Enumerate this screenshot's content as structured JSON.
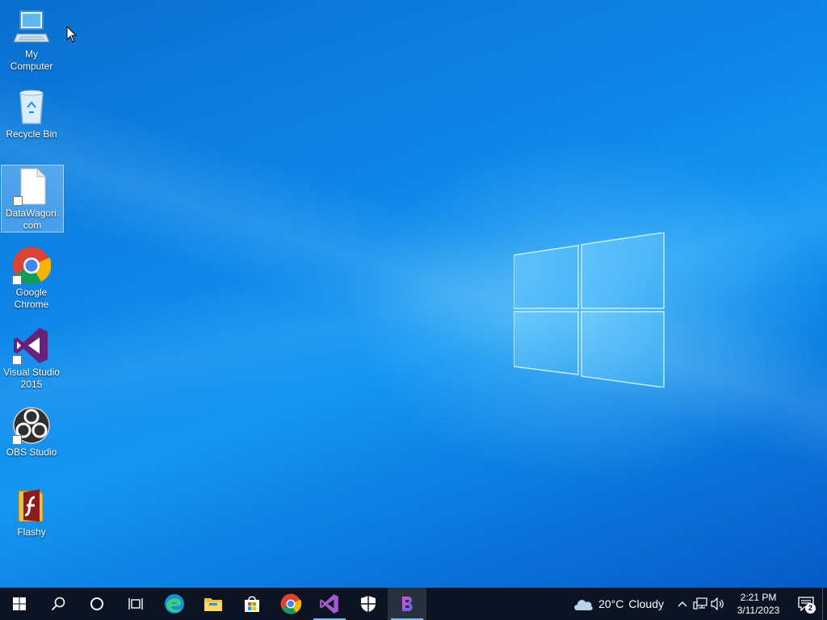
{
  "desktop": {
    "icons": [
      {
        "label": "My Computer",
        "icon": "computer-icon"
      },
      {
        "label": "Recycle Bin",
        "icon": "recycle-bin-icon"
      },
      {
        "label": "DataWagon.com",
        "icon": "file-shortcut-icon",
        "selected": true
      },
      {
        "label": "Google Chrome",
        "icon": "chrome-icon"
      },
      {
        "label": "Visual Studio 2015",
        "icon": "visual-studio-icon"
      },
      {
        "label": "OBS Studio",
        "icon": "obs-icon"
      },
      {
        "label": "Flashy",
        "icon": "flash-icon"
      }
    ]
  },
  "taskbar": {
    "buttons": [
      {
        "name": "start",
        "icon": "windows-start-icon"
      },
      {
        "name": "search",
        "icon": "search-icon"
      },
      {
        "name": "cortana",
        "icon": "cortana-circle-icon"
      },
      {
        "name": "task-view",
        "icon": "task-view-icon"
      },
      {
        "name": "edge",
        "icon": "edge-icon"
      },
      {
        "name": "file-explorer",
        "icon": "folder-icon"
      },
      {
        "name": "store",
        "icon": "store-icon"
      },
      {
        "name": "chrome",
        "icon": "chrome-icon"
      },
      {
        "name": "visual-studio",
        "icon": "visual-studio-icon",
        "running": true
      },
      {
        "name": "security",
        "icon": "shield-icon"
      },
      {
        "name": "app",
        "icon": "b-app-icon",
        "running": true,
        "active": true
      }
    ],
    "weather": {
      "temp": "20°C",
      "condition": "Cloudy",
      "icon": "cloud-icon"
    },
    "clock": {
      "time": "2:21 PM",
      "date": "3/11/2023"
    },
    "notifications": {
      "count": "2",
      "icon": "action-center-icon"
    }
  },
  "colors": {
    "taskbar": "#0c1424",
    "running_indicator": "#76b9ed",
    "wallpaper": "#0f86e8"
  }
}
